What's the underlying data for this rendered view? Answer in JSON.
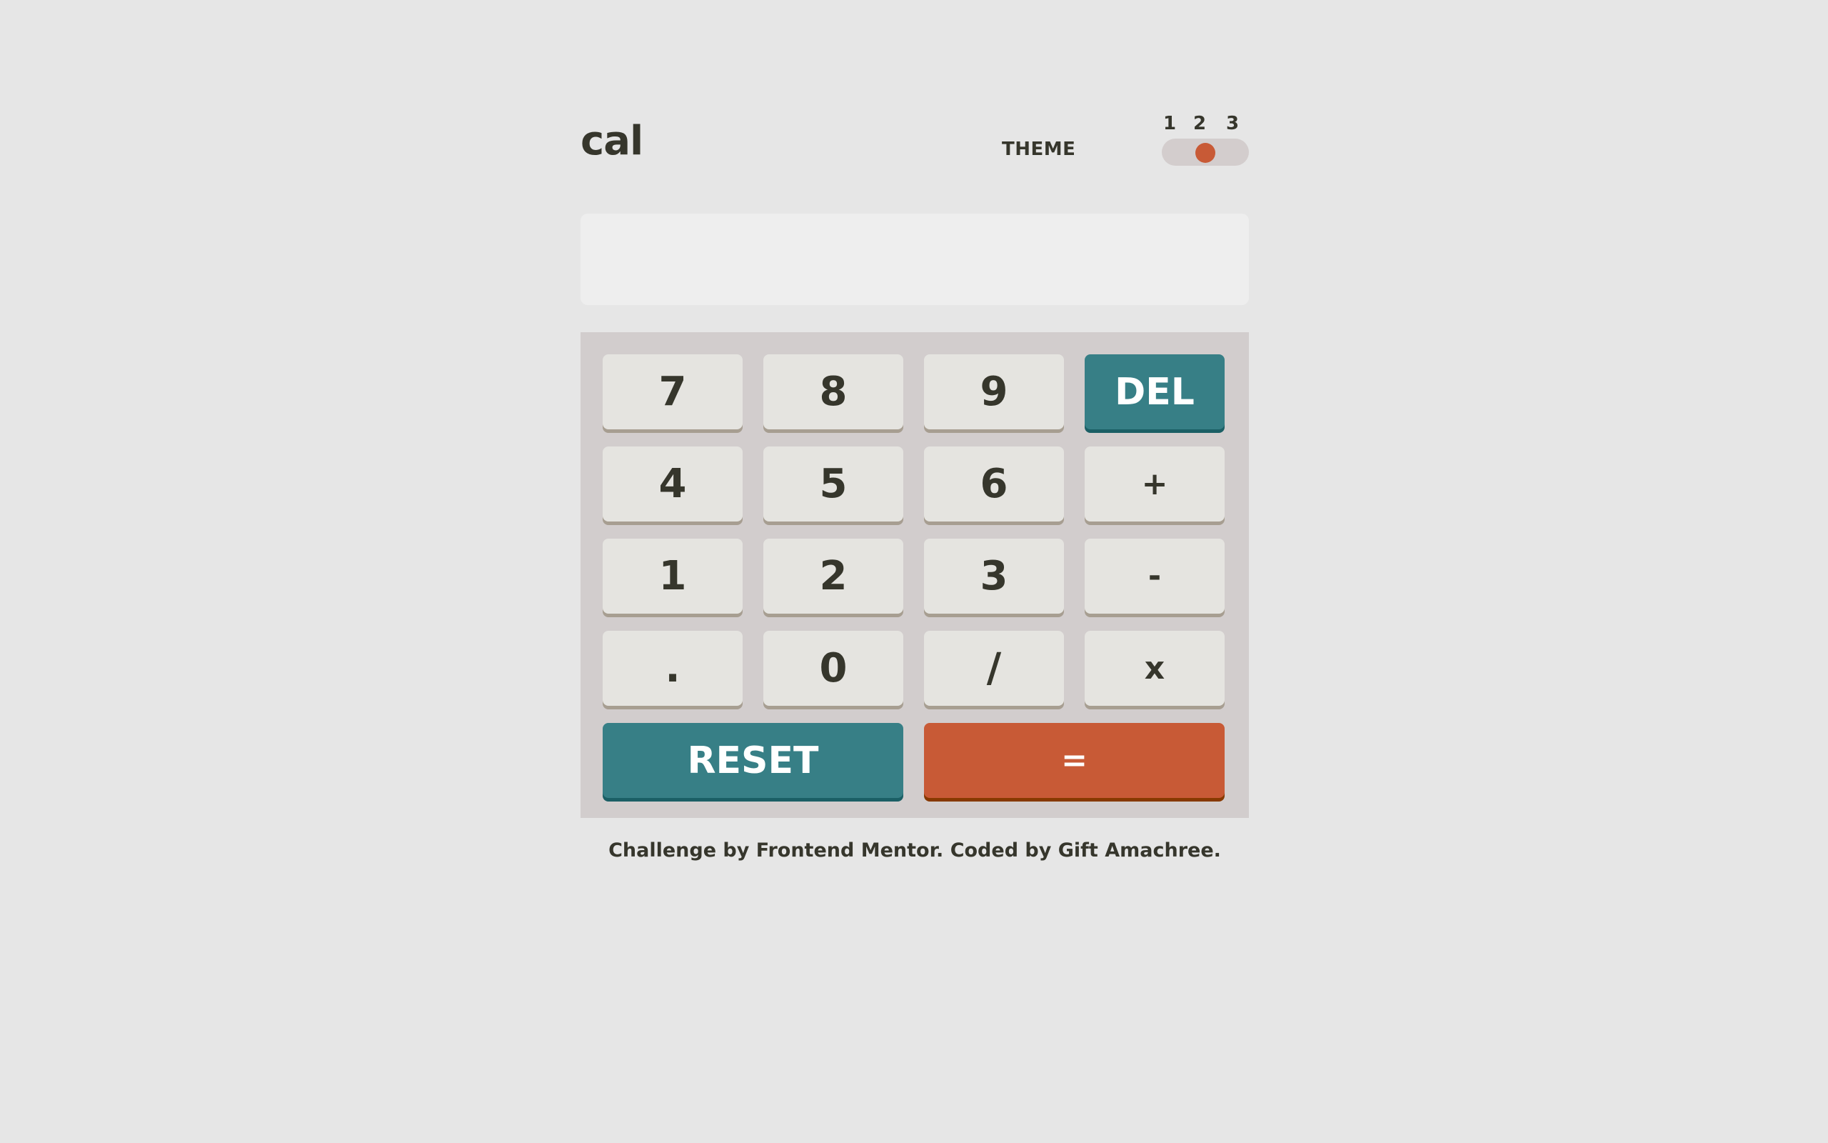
{
  "header": {
    "logo": "cal",
    "theme_label": "THEME",
    "theme_numbers": [
      "1",
      "2",
      "3"
    ],
    "selected_theme": 2
  },
  "screen": {
    "value": ""
  },
  "keypad": {
    "keys": [
      "7",
      "8",
      "9",
      "DEL",
      "4",
      "5",
      "6",
      "+",
      "1",
      "2",
      "3",
      "-",
      ".",
      "0",
      "/",
      "x"
    ],
    "reset_label": "RESET",
    "equals_label": "="
  },
  "footer": {
    "text": "Challenge by Frontend Mentor. Coded by Gift Amachree."
  },
  "colors": {
    "background": "#e6e6e6",
    "keypad_background": "#d2cdcd",
    "screen_background": "#eeeeee",
    "key_background": "#e5e4e0",
    "key_shadow": "#a79e91",
    "accent_teal": "#377f86",
    "accent_orange": "#c85a36",
    "text": "#36362c"
  }
}
